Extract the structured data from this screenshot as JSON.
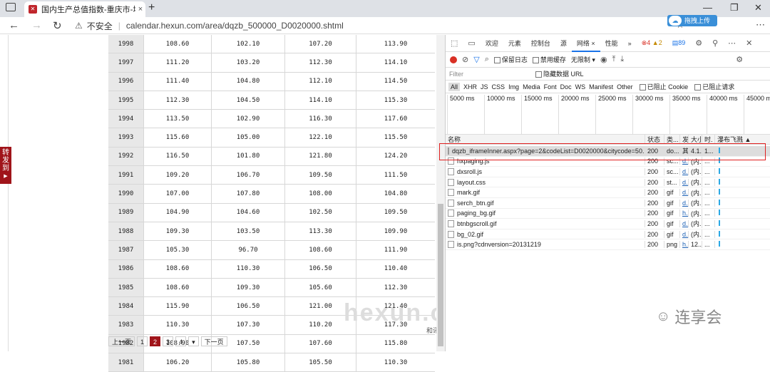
{
  "browser": {
    "tab_title": "国内生产总值指数-重庆市-地区",
    "close": "×",
    "newtab": "+",
    "not_secure": "不安全",
    "url": "calendar.hexun.com/area/dqzb_500000_D0020000.shtml",
    "cloud_label": "拖拽上传",
    "sync_label": "步"
  },
  "page": {
    "share": [
      "转",
      "发",
      "到"
    ],
    "rows": [
      {
        "year": "1998",
        "v": [
          "108.60",
          "102.10",
          "107.20",
          "113.90"
        ]
      },
      {
        "year": "1997",
        "v": [
          "111.20",
          "103.20",
          "112.30",
          "114.10"
        ]
      },
      {
        "year": "1996",
        "v": [
          "111.40",
          "104.80",
          "112.10",
          "114.50"
        ]
      },
      {
        "year": "1995",
        "v": [
          "112.30",
          "104.50",
          "114.10",
          "115.30"
        ]
      },
      {
        "year": "1994",
        "v": [
          "113.50",
          "102.90",
          "116.30",
          "117.60"
        ]
      },
      {
        "year": "1993",
        "v": [
          "115.60",
          "105.00",
          "122.10",
          "115.50"
        ]
      },
      {
        "year": "1992",
        "v": [
          "116.50",
          "101.80",
          "121.80",
          "124.20"
        ]
      },
      {
        "year": "1991",
        "v": [
          "109.20",
          "106.70",
          "109.50",
          "111.50"
        ]
      },
      {
        "year": "1990",
        "v": [
          "107.00",
          "107.80",
          "108.00",
          "104.80"
        ]
      },
      {
        "year": "1989",
        "v": [
          "104.90",
          "104.60",
          "102.50",
          "109.50"
        ]
      },
      {
        "year": "1988",
        "v": [
          "109.30",
          "103.50",
          "113.30",
          "109.90"
        ]
      },
      {
        "year": "1987",
        "v": [
          "105.30",
          "96.70",
          "108.60",
          "111.90"
        ]
      },
      {
        "year": "1986",
        "v": [
          "108.60",
          "110.30",
          "106.50",
          "110.40"
        ]
      },
      {
        "year": "1985",
        "v": [
          "108.60",
          "109.30",
          "105.60",
          "112.30"
        ]
      },
      {
        "year": "1984",
        "v": [
          "115.90",
          "106.50",
          "121.00",
          "121.40"
        ]
      },
      {
        "year": "1983",
        "v": [
          "110.30",
          "107.30",
          "110.20",
          "117.30"
        ]
      },
      {
        "year": "1982",
        "v": [
          "108.90",
          "107.50",
          "107.60",
          "115.80"
        ]
      },
      {
        "year": "1981",
        "v": [
          "106.20",
          "105.80",
          "105.50",
          "110.30"
        ]
      }
    ],
    "watermark": "hexun.co",
    "note": "和讯",
    "pager": [
      "上一页",
      "1",
      "2",
      "3",
      "4",
      "下一页"
    ]
  },
  "devtools": {
    "tabs": [
      "欢迎",
      "元素",
      "控制台",
      "源",
      "网络",
      "性能",
      "»"
    ],
    "errors": "4",
    "warnings": "2",
    "issues": "89",
    "toolbar": {
      "preserve_log": "保留日志",
      "disable_cache": "禁用缓存",
      "throttle": "无限制"
    },
    "filter_placeholder": "Filter",
    "hide_data_url": "隐藏数据 URL",
    "types": [
      "All",
      "XHR",
      "JS",
      "CSS",
      "Img",
      "Media",
      "Font",
      "Doc",
      "WS",
      "Manifest",
      "Other"
    ],
    "blocked_cookie": "已阻止 Cookie",
    "blocked_requests": "已阻止请求",
    "timeline": [
      "5000 ms",
      "10000 ms",
      "15000 ms",
      "20000 ms",
      "25000 ms",
      "30000 ms",
      "35000 ms",
      "40000 ms",
      "45000 ms"
    ],
    "columns": [
      "名称",
      "状态",
      "类...",
      "发",
      "大小",
      "时.",
      "瀑布飞溅"
    ],
    "requests": [
      {
        "name": "dqzb_iframeInner.aspx?page=2&codeList=D0020000&citycode=50...",
        "status": "200",
        "type": "do...",
        "init": "其...",
        "size": "4.1...",
        "time": "1..."
      },
      {
        "name": "hxpaging.js",
        "status": "200",
        "type": "sc...",
        "init": "d...",
        "size": "(内...",
        "time": "..."
      },
      {
        "name": "dxsroll.js",
        "status": "200",
        "type": "sc...",
        "init": "d...",
        "size": "(内...",
        "time": "..."
      },
      {
        "name": "layout.css",
        "status": "200",
        "type": "st...",
        "init": "d...",
        "size": "(内...",
        "time": "..."
      },
      {
        "name": "mark.gif",
        "status": "200",
        "type": "gif",
        "init": "d...",
        "size": "(内...",
        "time": "..."
      },
      {
        "name": "serch_btn.gif",
        "status": "200",
        "type": "gif",
        "init": "d...",
        "size": "(内...",
        "time": "..."
      },
      {
        "name": "paging_bg.gif",
        "status": "200",
        "type": "gif",
        "init": "h...",
        "size": "(内...",
        "time": "..."
      },
      {
        "name": "btnbgscroll.gif",
        "status": "200",
        "type": "gif",
        "init": "d...",
        "size": "(内...",
        "time": "..."
      },
      {
        "name": "bg_02.gif",
        "status": "200",
        "type": "gif",
        "init": "d...",
        "size": "(内...",
        "time": "..."
      },
      {
        "name": "is.png?cdnversion=20131219",
        "status": "200",
        "type": "png",
        "init": "h...",
        "size": "12...",
        "time": "..."
      }
    ]
  },
  "wechat": {
    "name": "连享会"
  }
}
